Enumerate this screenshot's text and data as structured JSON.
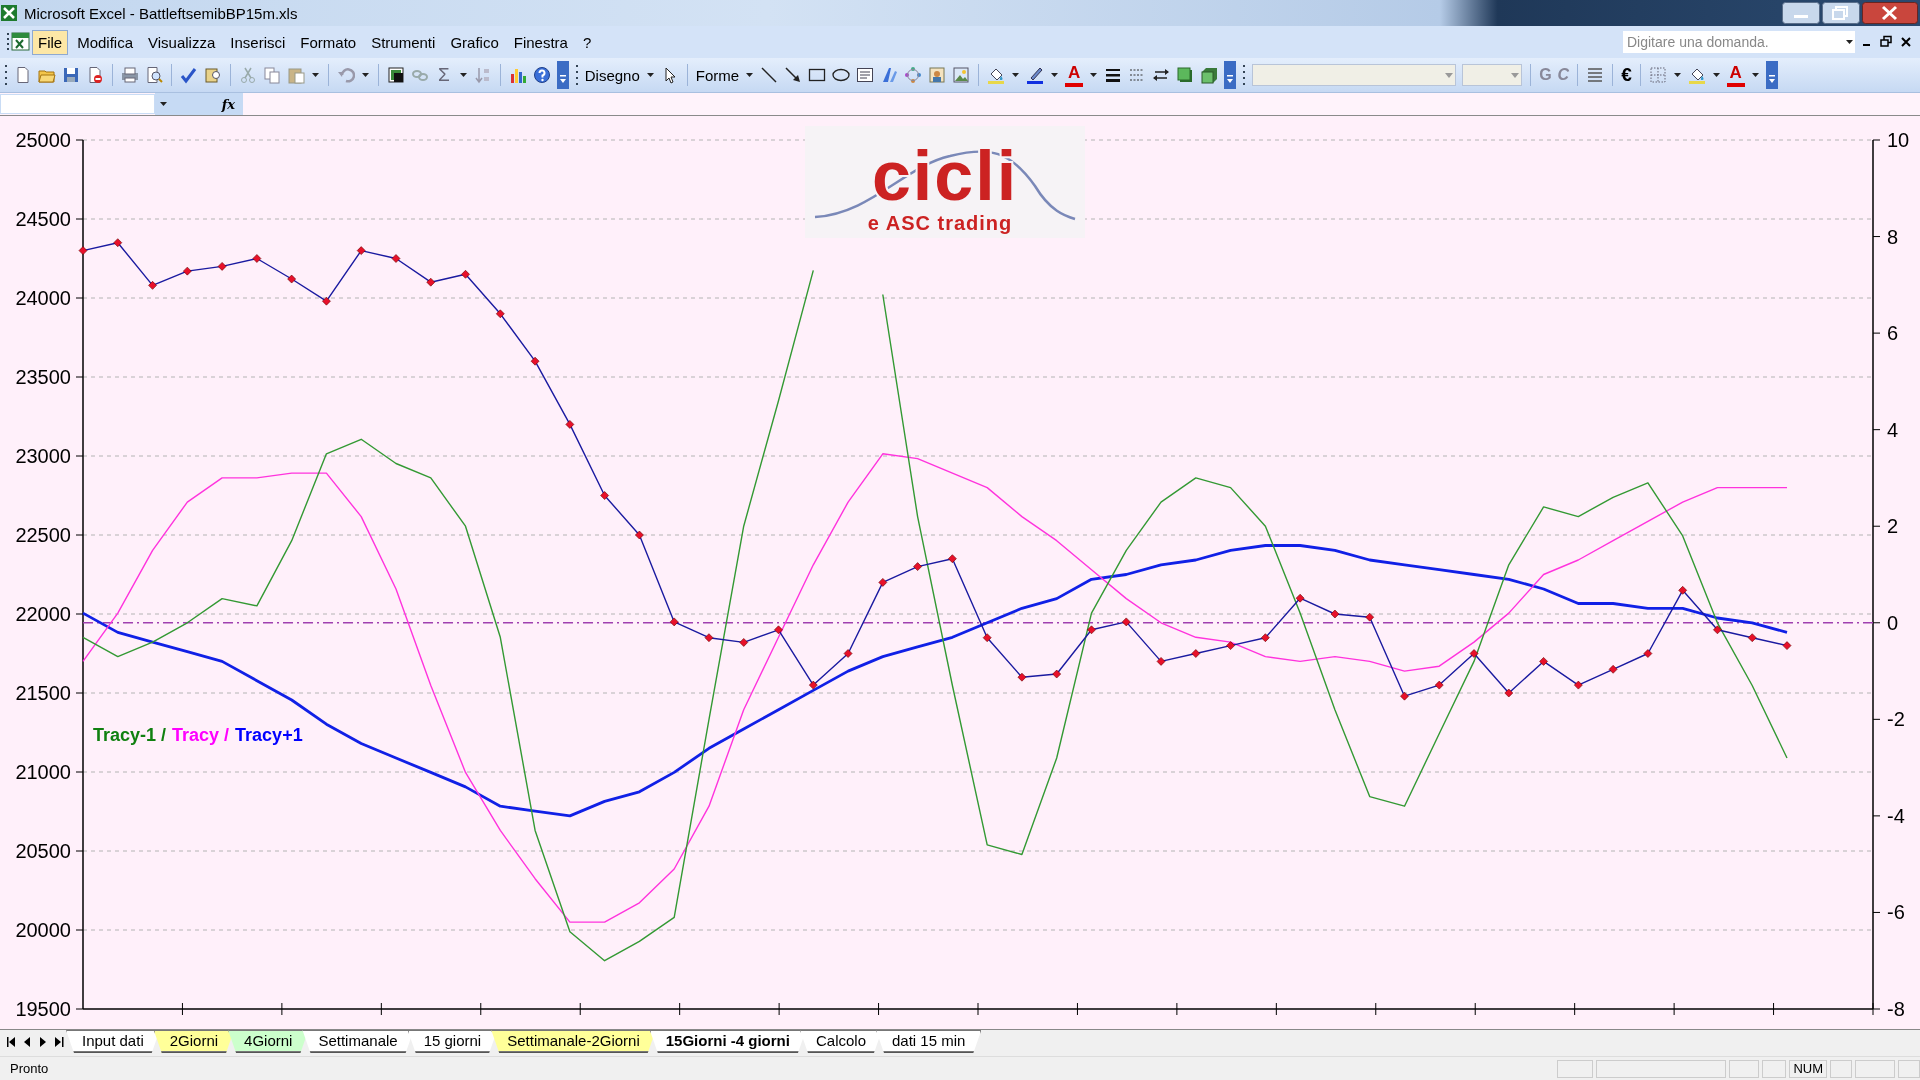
{
  "window": {
    "title": "Microsoft Excel - BattleftsemibBP15m.xls"
  },
  "menu": [
    {
      "label": "File",
      "selected": true
    },
    {
      "label": "Modifica",
      "selected": false
    },
    {
      "label": "Visualizza",
      "selected": false
    },
    {
      "label": "Inserisci",
      "selected": false
    },
    {
      "label": "Formato",
      "selected": false
    },
    {
      "label": "Strumenti",
      "selected": false
    },
    {
      "label": "Grafico",
      "selected": false
    },
    {
      "label": "Finestra",
      "selected": false
    },
    {
      "label": "?",
      "selected": false
    }
  ],
  "help_box": {
    "placeholder": "Digitare una domanda."
  },
  "toolbar": {
    "sum": "Σ",
    "draw_menu": "Disegno",
    "shapes_menu": "Forme",
    "drawing_font_color": "A",
    "bold": "G",
    "italic": "C",
    "euro": "€",
    "format_font_color": "A"
  },
  "formula_bar": {
    "fx": "fx"
  },
  "chart": {
    "logo": {
      "title": "cicli",
      "subtitle": "e ASC trading"
    },
    "legend": [
      {
        "color": "#108010",
        "separator": "/"
      },
      {
        "color": "#ff00ff",
        "separator": "/"
      },
      {
        "color": "#0000ff"
      }
    ],
    "series_styles": [
      {
        "kind": "line"
      },
      {
        "kind": "line"
      },
      {
        "kind": "line"
      },
      {
        "kind": "thick_line"
      }
    ],
    "chart_data": {
      "type": "line",
      "ylim": [
        19500,
        25000
      ],
      "yticks": [
        19500,
        20000,
        20500,
        21000,
        21500,
        22000,
        22500,
        23000,
        23500,
        24000,
        24500,
        25000
      ],
      "y2lim": [
        -8,
        10
      ],
      "y2ticks": [
        -8,
        -6,
        -4,
        -2,
        0,
        2,
        4,
        6,
        8,
        10
      ],
      "grid": true,
      "ref_lines": [
        {
          "axis": "y2",
          "value": 0,
          "color": "#a040b0"
        }
      ],
      "series": [
        {
          "color": "#1a1aa0",
          "marker": true,
          "values": [
            24300,
            24350,
            24080,
            24170,
            24200,
            24250,
            24120,
            23980,
            24300,
            24250,
            24100,
            24150,
            23900,
            23600,
            23200,
            22750,
            22500,
            21950,
            21850,
            21820,
            21900,
            21550,
            21750,
            22200,
            22300,
            22350,
            21850,
            21600,
            21620,
            21900,
            21950,
            21700,
            21750,
            21800,
            21850,
            22100,
            22000,
            21980,
            21480,
            21550,
            21750,
            21500,
            21700,
            21550,
            21650,
            21750,
            22150,
            21900,
            21850,
            21800
          ]
        },
        {
          "name": "Tracy-1",
          "axis": "y2",
          "color": "#339933",
          "values": [
            -0.3,
            -0.7,
            -0.4,
            0,
            0.5,
            0.35,
            1.7,
            3.5,
            3.8,
            3.3,
            3.0,
            2.0,
            -0.3,
            -4.3,
            -6.4,
            -7.0,
            -6.6,
            -6.1,
            -2.0,
            2.0,
            4.6,
            7.3,
            null,
            6.8,
            2.2,
            -1.3,
            -4.6,
            -4.8,
            -2.8,
            0.2,
            1.5,
            2.5,
            3.0,
            2.8,
            2.0,
            0.2,
            -1.8,
            -3.6,
            -3.8,
            -2.3,
            -0.8,
            1.2,
            2.4,
            2.2,
            2.6,
            2.9,
            1.8,
            0,
            -1.3,
            -2.8
          ]
        },
        {
          "name": "Tracy",
          "axis": "y2",
          "color": "#ff33dd",
          "values": [
            -0.8,
            0.2,
            1.5,
            2.5,
            3.0,
            3.0,
            3.1,
            3.1,
            2.2,
            0.7,
            -1.3,
            -3.1,
            -4.3,
            -5.3,
            -6.2,
            -6.2,
            -5.8,
            -5.1,
            -3.8,
            -1.8,
            -0.3,
            1.2,
            2.5,
            3.5,
            3.4,
            3.1,
            2.8,
            2.2,
            1.7,
            1.1,
            0.5,
            0,
            -0.3,
            -0.4,
            -0.7,
            -0.8,
            -0.7,
            -0.8,
            -1.0,
            -0.9,
            -0.4,
            0.2,
            1.0,
            1.3,
            1.7,
            2.1,
            2.5,
            2.8,
            2.8,
            2.8
          ]
        },
        {
          "name": "Tracy+1",
          "axis": "y2",
          "color": "#1020e6",
          "values": [
            0.2,
            -0.2,
            -0.4,
            -0.6,
            -0.8,
            -1.2,
            -1.6,
            -2.1,
            -2.5,
            -2.8,
            -3.1,
            -3.4,
            -3.8,
            -3.9,
            -4.0,
            -3.7,
            -3.5,
            -3.1,
            -2.6,
            -2.2,
            -1.8,
            -1.4,
            -1.0,
            -0.7,
            -0.5,
            -0.3,
            0,
            0.3,
            0.5,
            0.9,
            1.0,
            1.2,
            1.3,
            1.5,
            1.6,
            1.6,
            1.5,
            1.3,
            1.2,
            1.1,
            1.0,
            0.9,
            0.7,
            0.4,
            0.4,
            0.3,
            0.3,
            0.1,
            0,
            -0.2
          ]
        }
      ]
    }
  },
  "sheet_tabs": [
    {
      "label": "Input dati",
      "selected": false,
      "color": "#ffffff"
    },
    {
      "label": "2Giorni",
      "selected": false,
      "color": "#ffff99"
    },
    {
      "label": "4Giorni",
      "selected": false,
      "color": "#ccffcc"
    },
    {
      "label": "Settimanale",
      "selected": false,
      "color": "#ffffff"
    },
    {
      "label": "15 giorni",
      "selected": false,
      "color": "#ffffff"
    },
    {
      "label": "Settimanale-2Giorni",
      "selected": false,
      "color": "#ffff99"
    },
    {
      "label": "15Giorni -4 giorni",
      "selected": true,
      "color": "#ffffff"
    },
    {
      "label": "Calcolo",
      "selected": false,
      "color": "#ffffff"
    },
    {
      "label": "dati 15 min",
      "selected": false,
      "color": "#ffffff"
    }
  ],
  "status_bar": {
    "text": "Pronto",
    "indicators": [
      "NUM"
    ]
  }
}
